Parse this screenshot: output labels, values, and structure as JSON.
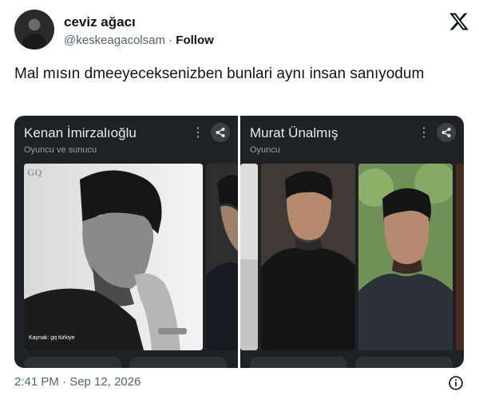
{
  "tweet": {
    "author_name": "ceviz ağacı",
    "handle": "@keskeagacolsam",
    "separator": "·",
    "follow_label": "Follow",
    "text": "Mal mısın dmeeyeceksenizben bunlari aynı insan sanıyodum",
    "timestamp": "2:41 PM · Sep 12, 2026"
  },
  "cards": [
    {
      "title": "Kenan İmirzalıoğlu",
      "subtitle": "Oyuncu ve sunucu",
      "watermark": "GQ",
      "source": "Kaynak: gq türkiye"
    },
    {
      "title": "Murat Ünalmış",
      "subtitle": "Oyuncu"
    }
  ],
  "icons": {
    "platform_logo": "x-logo-icon",
    "more": "more-vert-icon",
    "share": "share-icon",
    "info": "info-icon"
  },
  "colors": {
    "card_bg": "#202124",
    "text_primary": "#0f1419",
    "text_secondary": "#536471"
  }
}
